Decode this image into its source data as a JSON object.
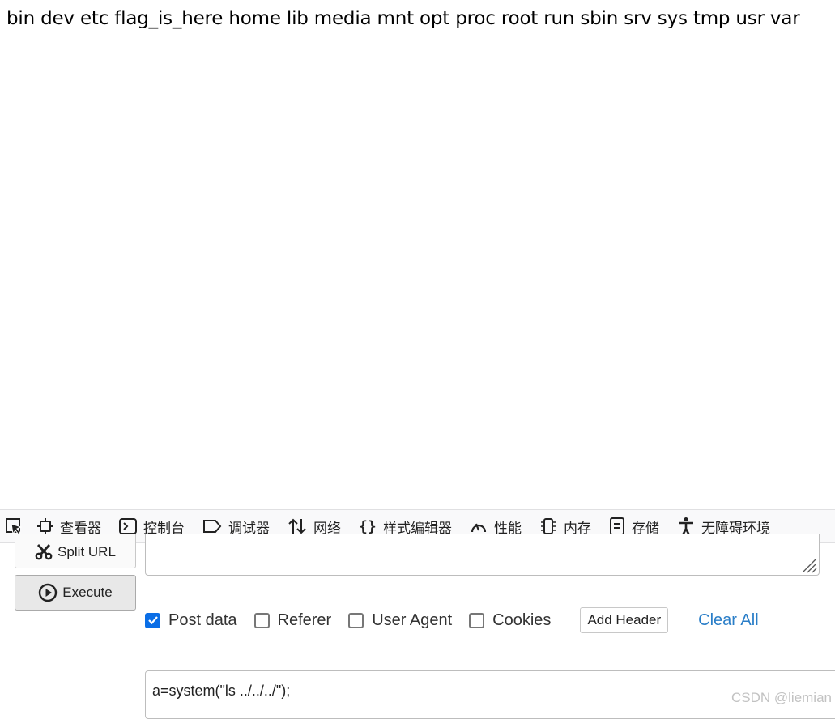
{
  "page_output": "bin dev etc flag_is_here home lib media mnt opt proc root run sbin srv sys tmp usr var",
  "devtools": {
    "tabs": [
      {
        "label": "查看器",
        "icon": "inspector-icon"
      },
      {
        "label": "控制台",
        "icon": "console-icon"
      },
      {
        "label": "调试器",
        "icon": "debugger-icon"
      },
      {
        "label": "网络",
        "icon": "network-icon"
      },
      {
        "label": "样式编辑器",
        "icon": "style-editor-icon"
      },
      {
        "label": "性能",
        "icon": "performance-icon"
      },
      {
        "label": "内存",
        "icon": "memory-icon"
      },
      {
        "label": "存储",
        "icon": "storage-icon"
      },
      {
        "label": "无障碍环境",
        "icon": "accessibility-icon"
      }
    ]
  },
  "hackbar": {
    "split_url_label": "Split URL",
    "execute_label": "Execute",
    "url_value": "",
    "options": {
      "post_data": {
        "label": "Post data",
        "checked": true
      },
      "referer": {
        "label": "Referer",
        "checked": false
      },
      "user_agent": {
        "label": "User Agent",
        "checked": false
      },
      "cookies": {
        "label": "Cookies",
        "checked": false
      }
    },
    "add_header_label": "Add Header",
    "clear_all_label": "Clear All",
    "post_body": "a=system(\"ls ../../../\");"
  },
  "watermark": "CSDN @liemian",
  "colors": {
    "accent": "#0a6ee6",
    "link": "#2a7ec8"
  }
}
